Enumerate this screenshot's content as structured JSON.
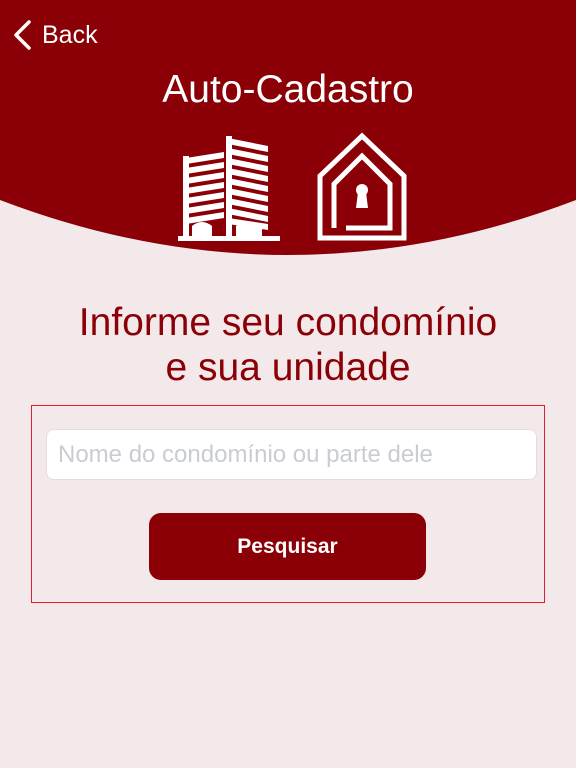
{
  "colors": {
    "brand": "#8b0006",
    "background": "#f3e8ea",
    "form_border": "#d9232e",
    "placeholder": "#c9ccd2"
  },
  "nav": {
    "back_label": "Back",
    "back_icon": "chevron-left-icon"
  },
  "header": {
    "title": "Auto-Cadastro",
    "icons": [
      "buildings-icon",
      "house-lock-icon"
    ]
  },
  "main": {
    "subtitle_line1": "Informe seu condomínio",
    "subtitle_line2": "e sua unidade",
    "search_placeholder": "Nome do condomínio ou parte dele",
    "search_value": "",
    "search_button_label": "Pesquisar"
  }
}
